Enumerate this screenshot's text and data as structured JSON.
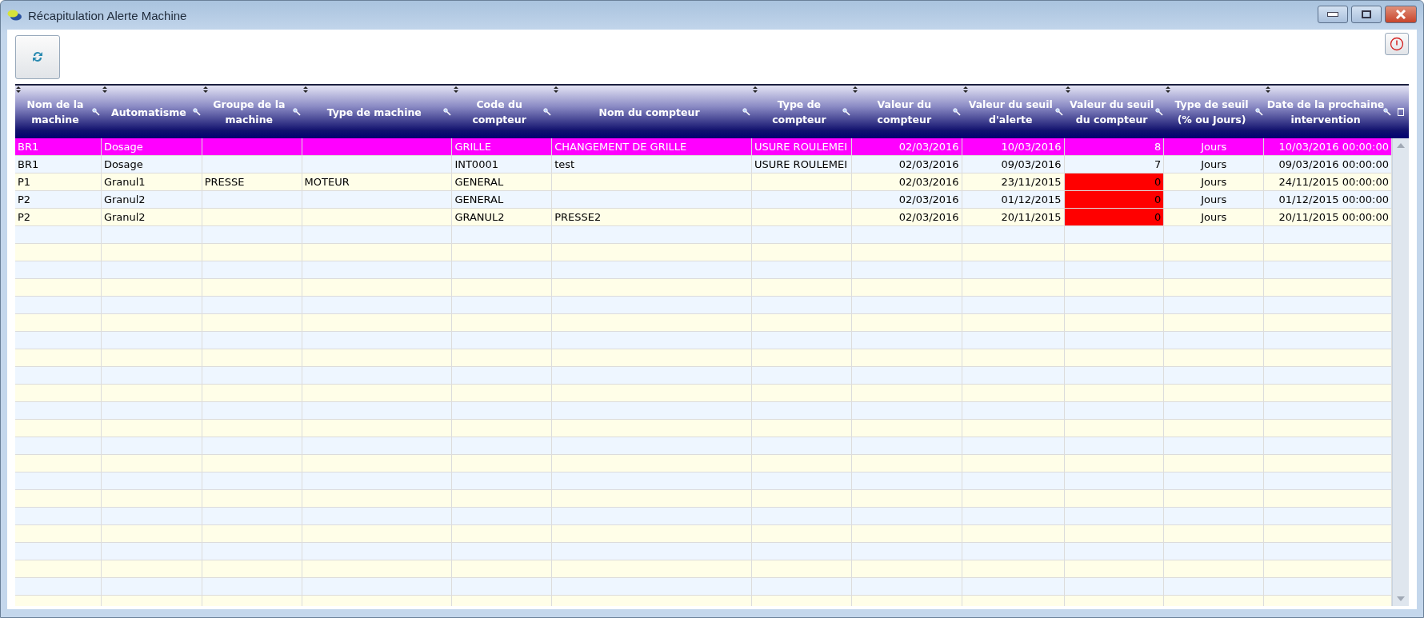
{
  "window": {
    "title": "Récapitulation Alerte Machine"
  },
  "table": {
    "columns": [
      "Nom de la machine",
      "Automatisme",
      "Groupe de la machine",
      "Type de machine",
      "Code du compteur",
      "Nom du compteur",
      "Type de compteur",
      "Valeur du compteur",
      "Valeur du seuil d'alerte",
      "Valeur du seuil du compteur",
      "Type de seuil (% ou Jours)",
      "Date de la prochaine intervention"
    ],
    "rows": [
      {
        "selected": true,
        "alert": false,
        "cells": [
          "BR1",
          "Dosage",
          "",
          "",
          "GRILLE",
          "CHANGEMENT DE GRILLE",
          "USURE ROULEMEI",
          "02/03/2016",
          "10/03/2016",
          "8",
          "Jours",
          "10/03/2016 00:00:00"
        ]
      },
      {
        "selected": false,
        "alert": false,
        "cells": [
          "BR1",
          "Dosage",
          "",
          "",
          "INT0001",
          "test",
          "USURE ROULEMEI",
          "02/03/2016",
          "09/03/2016",
          "7",
          "Jours",
          "09/03/2016 00:00:00"
        ]
      },
      {
        "selected": false,
        "alert": true,
        "cells": [
          "P1",
          "Granul1",
          "PRESSE",
          "MOTEUR",
          "GENERAL",
          "",
          "",
          "02/03/2016",
          "23/11/2015",
          "0",
          "Jours",
          "24/11/2015 00:00:00"
        ]
      },
      {
        "selected": false,
        "alert": true,
        "cells": [
          "P2",
          "Granul2",
          "",
          "",
          "GENERAL",
          "",
          "",
          "02/03/2016",
          "01/12/2015",
          "0",
          "Jours",
          "01/12/2015 00:00:00"
        ]
      },
      {
        "selected": false,
        "alert": true,
        "cells": [
          "P2",
          "Granul2",
          "",
          "",
          "GRANUL2",
          "PRESSE2",
          "",
          "02/03/2016",
          "20/11/2015",
          "0",
          "Jours",
          "20/11/2015 00:00:00"
        ]
      }
    ]
  }
}
